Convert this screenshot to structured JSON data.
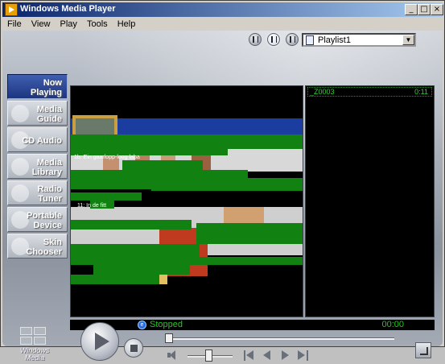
{
  "window": {
    "title": "Windows Media Player",
    "caption_buttons": {
      "minimize": "_",
      "maximize": "□",
      "close": "×"
    }
  },
  "menubar": {
    "items": [
      "File",
      "View",
      "Play",
      "Tools",
      "Help"
    ]
  },
  "toolbar": {
    "icons": [
      "equalizer-icon",
      "media-info-icon",
      "shuffle-icon"
    ],
    "playlist_selected": "Playlist1"
  },
  "nav": {
    "items": [
      {
        "label": "Now\nPlaying",
        "selected": true
      },
      {
        "label": "Media\nGuide",
        "selected": false
      },
      {
        "label": "CD Audio",
        "selected": false
      },
      {
        "label": "Media\nLibrary",
        "selected": false
      },
      {
        "label": "Radio\nTuner",
        "selected": false
      },
      {
        "label": "Portable\nDevice",
        "selected": false
      },
      {
        "label": "Skin\nChooser",
        "selected": false
      }
    ]
  },
  "video": {
    "overlay_caption_1": "1b: Ein gaarlopp-loog laba",
    "overlay_caption_2": "11: In de fitt"
  },
  "playlist": {
    "items": [
      {
        "name": "_Z0003",
        "duration": "0:11"
      }
    ]
  },
  "status": {
    "state": "Stopped",
    "time": "00:00"
  },
  "playback": {
    "seek_position": 0.0,
    "volume": 0.4
  },
  "logo": {
    "text": "Windows\nMedia"
  },
  "colors": {
    "title_bar_start": "#0a246a",
    "title_bar_end": "#a6caf0",
    "status_green": "#22c822",
    "video_glitch_green": "#118211",
    "nav_selected": "#2b4a9c"
  }
}
